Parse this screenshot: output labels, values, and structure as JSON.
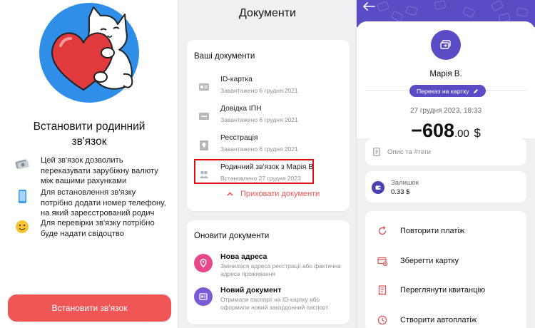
{
  "panel1": {
    "title": "Встановити родинний зв'язок",
    "info": [
      {
        "icon": "money-icon",
        "text": "Цей зв'язок дозволить переказувати зарубіжну валюту між вашими рахунками"
      },
      {
        "icon": "phone-icon",
        "text": "Для встановлення зв'язку потрібно додати номер телефону, на який зареєстрований родич"
      },
      {
        "icon": "smile-emoji-icon",
        "text": "Для перевірки зв'язку потрібно буде надати свідоцтво"
      }
    ],
    "button_label": "Встановити зв'язок",
    "colors": {
      "accent": "#f05656",
      "hero_circle": "#2f8fe8",
      "heart": "#e03a3f"
    }
  },
  "panel2": {
    "title": "Документи",
    "your_documents": {
      "heading": "Ваші документи",
      "items": [
        {
          "name": "ID-картка",
          "status": "Завантажено 6 грудня 2021",
          "icon": "id-card-icon"
        },
        {
          "name": "Довідка ІПН",
          "status": "Завантажено 6 грудня 2021",
          "icon": "tax-certificate-icon"
        },
        {
          "name": "Реєстрація",
          "status": "Завантажено 6 грудня 2021",
          "icon": "location-pin-icon"
        },
        {
          "name": "Родинний зв'язок з Марія В",
          "status": "Встановлено 27 грудня 2023",
          "icon": "family-icon"
        }
      ],
      "hide_label": "Приховати документи"
    },
    "update_documents": {
      "heading": "Оновити документи",
      "items": [
        {
          "name": "Нова адреса",
          "description": "Змінилася адреса реєстрації або фактична адреса проживання",
          "icon": "map-pin-icon",
          "color": "#e8488a"
        },
        {
          "name": "Новий документ",
          "description": "Отримали паспорт на ID-картку або оформили новий закордонний паспорт",
          "icon": "document-icon",
          "color": "#7a5bd6"
        }
      ]
    },
    "colors": {
      "accent": "#f05656",
      "highlight": "#e01010"
    }
  },
  "panel3": {
    "recipient": "Марія В.",
    "transfer_label": "Переказ на картку",
    "date": "27 грудня 2023, 18:33",
    "amount_major": "−608",
    "amount_minor": ".00",
    "currency": "$",
    "comment_placeholder": "Опис та #теги",
    "balance": {
      "label": "Залишок",
      "value": "0.33 $"
    },
    "actions": [
      {
        "label": "Повторити платіж",
        "icon": "repeat-icon"
      },
      {
        "label": "Зберегти картку",
        "icon": "save-card-icon"
      },
      {
        "label": "Переглянути квитанцію",
        "icon": "receipt-icon"
      },
      {
        "label": "Створити автоплатіж",
        "icon": "autopay-clock-icon"
      }
    ],
    "colors": {
      "brand": "#5a4cc4",
      "action_icon": "#e05757"
    }
  }
}
